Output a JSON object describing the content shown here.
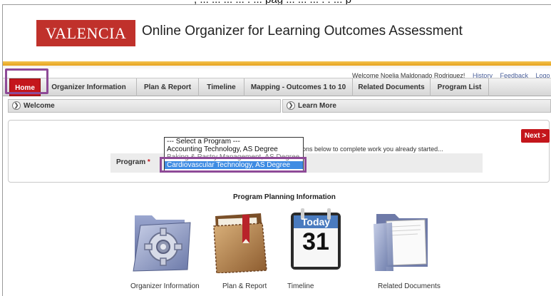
{
  "window_top_text": ", ... ... ... ... . ... pag ... ... ... . . ... p",
  "header": {
    "logo_text": "VALENCIA",
    "app_title": "Online Organizer for Learning Outcomes Assessment"
  },
  "user_bar": {
    "welcome": "Welcome Noelia Maldonado Rodriguez!",
    "history": "History",
    "feedback": "Feedback",
    "logout": "Logo"
  },
  "nav": {
    "items": [
      {
        "label": "Home"
      },
      {
        "label": "Organizer Information"
      },
      {
        "label": "Plan & Report"
      },
      {
        "label": "Timeline"
      },
      {
        "label": "Mapping - Outcomes 1 to 10"
      },
      {
        "label": "Related Documents"
      },
      {
        "label": "Program List"
      }
    ]
  },
  "panels": {
    "welcome": "Welcome",
    "learn_more": "Learn More"
  },
  "program_selector": {
    "next_label": "Next >",
    "hint": "ons below to complete work you already started...",
    "label": "Program",
    "required_mark": "*",
    "options": [
      "--- Select a Program ---",
      "Accounting Technology, AS Degree",
      "Baking & Pastry Management, AS Degree",
      "Cardiovascular Technology, AS Degree"
    ],
    "selected": "Cardiovascular Technology, AS Degree"
  },
  "planning": {
    "title": "Program Planning Information",
    "icons": [
      {
        "label": "Organizer Information",
        "icon": "gear-folder-icon"
      },
      {
        "label": "Plan & Report",
        "icon": "leather-folder-icon"
      },
      {
        "label": "Timeline",
        "icon": "calendar-icon",
        "calendar_word": "Today",
        "calendar_day": "31"
      },
      {
        "label": "Related Documents",
        "icon": "document-folder-icon"
      }
    ]
  },
  "colors": {
    "brand_red": "#c4161c",
    "gold": "#e6a21c",
    "highlight_purple": "#8e4a97",
    "selection_blue": "#3f8ce3"
  }
}
